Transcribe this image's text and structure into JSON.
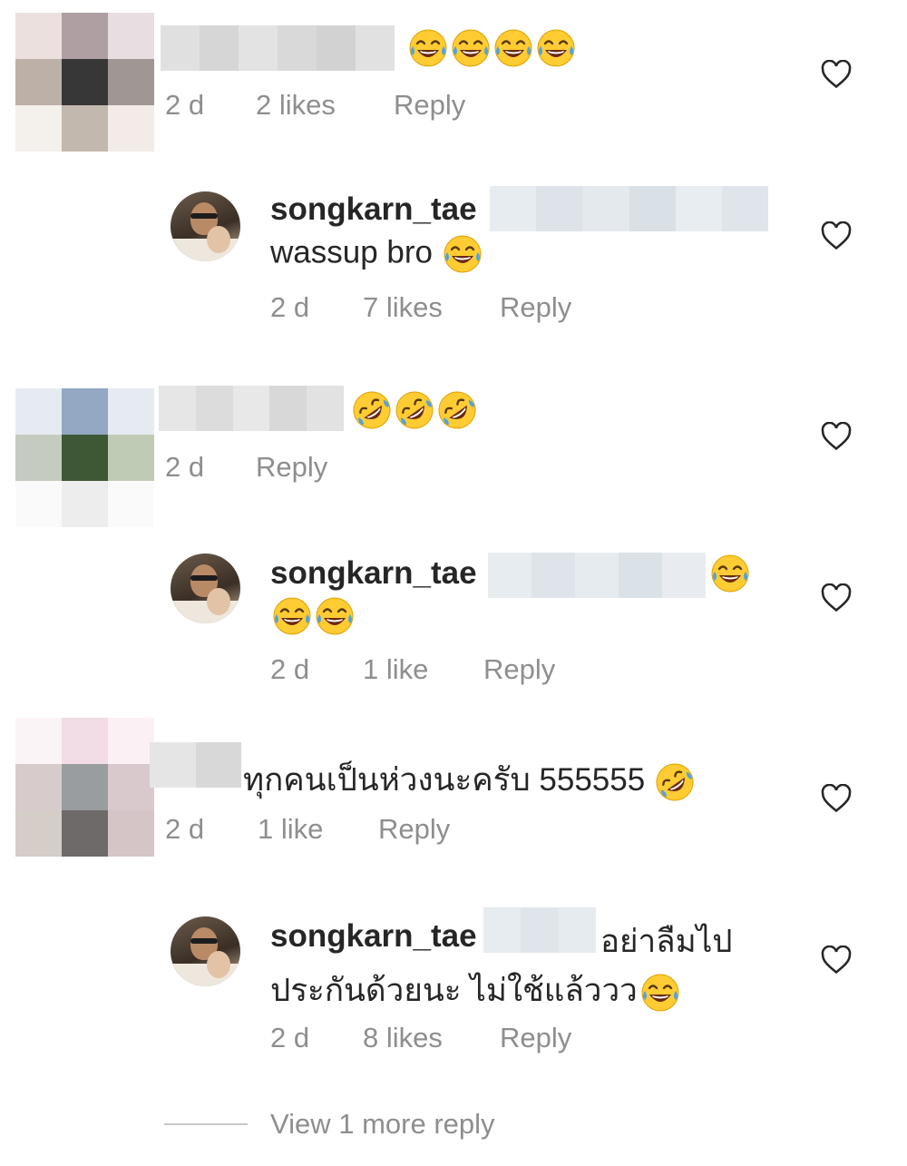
{
  "comments": [
    {
      "avatar_colors": [
        "#ece0df",
        "#b09fa2",
        "#e8dde0",
        "#bdb0a6",
        "#373737",
        "#a09794",
        "#f4f0ec",
        "#c3b8ad",
        "#f2ebe7"
      ],
      "blurred_colors": [
        "#e0e0e0",
        "#d6d6d6",
        "#e3e3e3",
        "#d9d9d9",
        "#d2d2d2",
        "#e1e1e1"
      ],
      "emojis": [
        "face-with-tears-of-joy",
        "face-with-tears-of-joy",
        "face-with-tears-of-joy",
        "face-with-tears-of-joy"
      ],
      "time": "2 d",
      "likes": "2 likes",
      "reply": "Reply"
    },
    {
      "avatar_colors": [
        "#e6ebf1",
        "#94a8c3",
        "#e6ebf2",
        "#c6cbc0",
        "#3e5735",
        "#c0cbb6",
        "#fafafa",
        "#ededed",
        "#fafafa"
      ],
      "blurred_colors": [
        "#e6e6e6",
        "#dcdcdc",
        "#e8e8e8",
        "#d8d8d8",
        "#e2e2e2"
      ],
      "emojis": [
        "rolling-on-floor-laughing",
        "rolling-on-floor-laughing",
        "rolling-on-floor-laughing"
      ],
      "time": "2 d",
      "reply": "Reply"
    },
    {
      "avatar_colors": [
        "#fbf4f6",
        "#f2dde6",
        "#fbf1f4",
        "#d7cccb",
        "#9a9d9f",
        "#d9c9cd",
        "#d5cdc8",
        "#6f6a6a",
        "#d5c5c7"
      ],
      "blurred_colors": [
        "#e5e5e5",
        "#d8d8d8"
      ],
      "text": "ทุกคนเป็นห่วงนะครับ 555555",
      "emojis": [
        "rolling-on-floor-laughing"
      ],
      "time": "2 d",
      "likes": "1 like",
      "reply": "Reply"
    }
  ],
  "replies": [
    {
      "username": "songkarn_tae",
      "blurred_colors": [
        "#e7ecf0",
        "#dde3e9",
        "#e4e9ee",
        "#d9e0e6",
        "#e8edf1",
        "#dfe5ea"
      ],
      "text": "wassup bro",
      "emojis": [
        "face-with-tears-of-joy"
      ],
      "time": "2 d",
      "likes": "7 likes",
      "reply": "Reply"
    },
    {
      "username": "songkarn_tae",
      "blurred_colors": [
        "#e7ecf0",
        "#dee4e9",
        "#e6ebef",
        "#dbe2e7",
        "#e8ecf0"
      ],
      "emojis_line1": [
        "face-with-tears-of-joy"
      ],
      "emojis_line2": [
        "face-with-tears-of-joy",
        "face-with-tears-of-joy"
      ],
      "time": "2 d",
      "likes": "1 like",
      "reply": "Reply"
    },
    {
      "username": "songkarn_tae",
      "blurred_colors": [
        "#e7ecf0",
        "#dfe5ea",
        "#e6ebef"
      ],
      "text_line1": "อย่าลืมไป",
      "text_line2": "ประกันด้วยนะ ไม่ใช้แล้ววว",
      "emojis": [
        "face-with-tears-of-joy"
      ],
      "time": "2 d",
      "likes": "8 likes",
      "reply": "Reply"
    }
  ],
  "view_more": "View 1 more reply",
  "icons": {
    "like": "heart-outline-icon"
  },
  "colors": {
    "meta": "#8e8e8e",
    "text": "#262626",
    "heart": "#262626"
  }
}
